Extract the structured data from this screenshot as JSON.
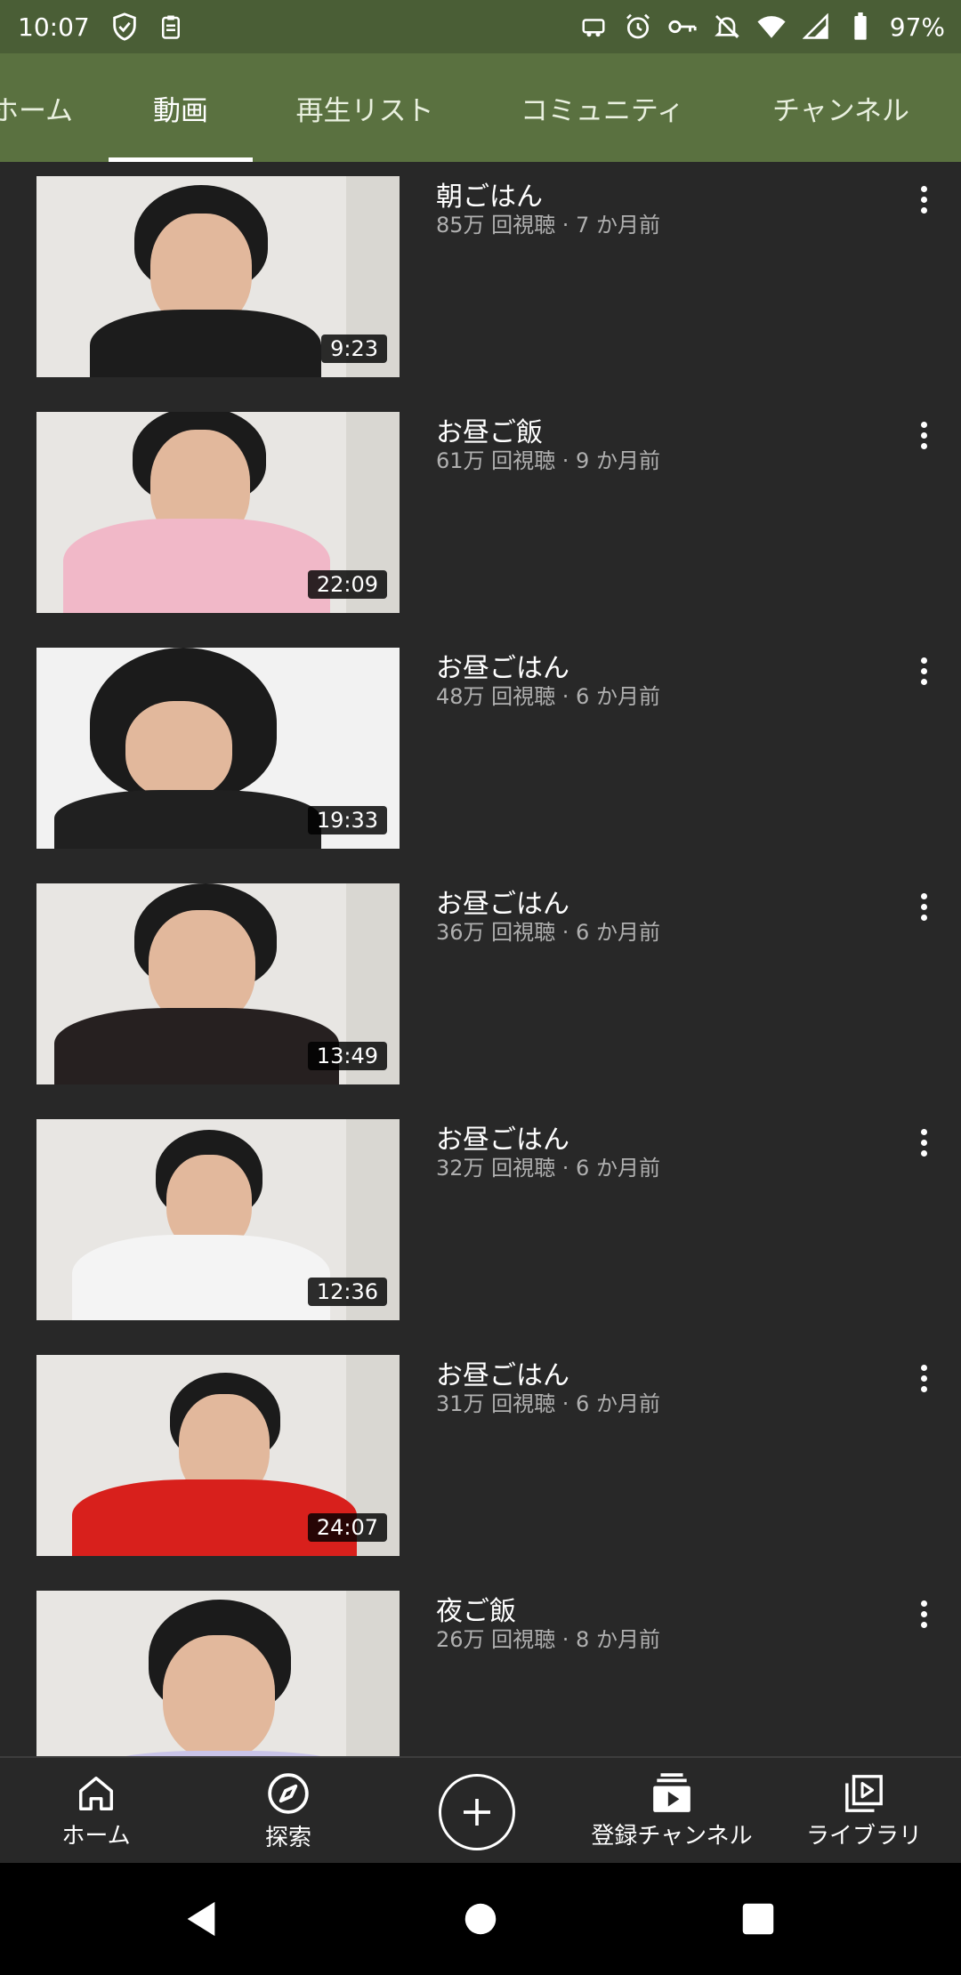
{
  "status_bar": {
    "time": "10:07",
    "battery": "97%"
  },
  "tabs": [
    {
      "label": "ホーム",
      "active": false
    },
    {
      "label": "動画",
      "active": true
    },
    {
      "label": "再生リスト",
      "active": false
    },
    {
      "label": "コミュニティ",
      "active": false
    },
    {
      "label": "チャンネル",
      "active": false
    }
  ],
  "videos": [
    {
      "title": "朝ごはん",
      "meta": "85万 回視聴 · 7 か月前",
      "duration": "9:23"
    },
    {
      "title": "お昼ご飯",
      "meta": "61万 回視聴 · 9 か月前",
      "duration": "22:09"
    },
    {
      "title": "お昼ごはん",
      "meta": "48万 回視聴 · 6 か月前",
      "duration": "19:33"
    },
    {
      "title": "お昼ごはん",
      "meta": "36万 回視聴 · 6 か月前",
      "duration": "13:49"
    },
    {
      "title": "お昼ごはん",
      "meta": "32万 回視聴 · 6 か月前",
      "duration": "12:36"
    },
    {
      "title": "お昼ごはん",
      "meta": "31万 回視聴 · 6 か月前",
      "duration": "24:07"
    },
    {
      "title": "夜ご飯",
      "meta": "26万 回視聴 · 8 か月前",
      "duration": ""
    }
  ],
  "bottom_nav": [
    {
      "label": "ホーム",
      "icon": "home-icon"
    },
    {
      "label": "探索",
      "icon": "explore-icon"
    },
    {
      "label": "",
      "icon": "add-icon"
    },
    {
      "label": "登録チャンネル",
      "icon": "subscriptions-icon"
    },
    {
      "label": "ライブラリ",
      "icon": "library-icon"
    }
  ],
  "colors": {
    "status_bar": "#4a5e36",
    "tab_bar": "#5a7140",
    "background": "#282828"
  }
}
